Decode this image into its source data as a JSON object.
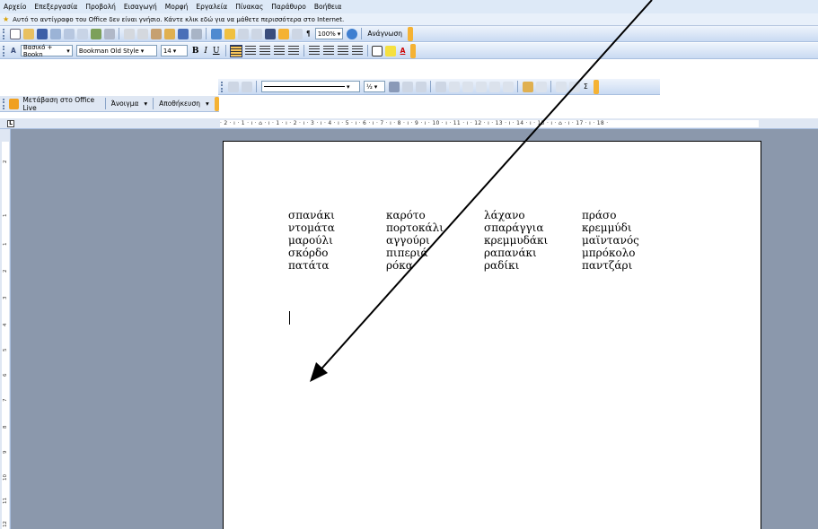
{
  "menu": [
    "Αρχείο",
    "Επεξεργασία",
    "Προβολή",
    "Εισαγωγή",
    "Μορφή",
    "Εργαλεία",
    "Πίνακας",
    "Παράθυρο",
    "Βοήθεια"
  ],
  "infobar": {
    "message": "Αυτό το αντίγραφο του Office δεν είναι γνήσιο. Κάντε κλικ εδώ για να μάθετε περισσότερα στο Internet."
  },
  "standard_toolbar": {
    "zoom": "100%",
    "read_button": "Ανάγνωση"
  },
  "format_toolbar": {
    "style": "Βασικό + Bookn",
    "font": "Bookman Old Style",
    "size": "14",
    "bold": "B",
    "italic": "I",
    "underline": "U"
  },
  "office_live_toolbar": {
    "goto_label": "Μετάβαση στο Office Live",
    "open_label": "Άνοιγμα",
    "save_label": "Αποθήκευση"
  },
  "drawing_toolbar": {
    "line_weight": "½"
  },
  "ruler": {
    "horizontal": "· 2 · ı · 1 · ı · ⌂ · ı · 1 · ı · 2 · ı · 3 · ı · 4 · ı · 5 · ı · 6 · ı · 7 · ı · 8 · ı · 9 · ı · 10 · ı · 11 · ı · 12 · ı · 13 · ı · 14 · ı · 15 · ı · ⌂ · ı · 17 · ı · 18 ·",
    "vertical": [
      "2",
      "1",
      "1",
      "2",
      "3",
      "4",
      "5",
      "6",
      "7",
      "8",
      "9",
      "10",
      "11",
      "12"
    ]
  },
  "document": {
    "rows": [
      [
        "σπανάκι",
        "καρότο",
        "λάχανο",
        "πράσο"
      ],
      [
        "ντομάτα",
        "πορτοκάλι",
        "σπαράγγια",
        "κρεμμύδι"
      ],
      [
        "μαρούλι",
        "αγγούρι",
        "κρεμμυδάκι",
        "μαϊντανός"
      ],
      [
        "σκόρδο",
        "πιπεριά",
        "ραπανάκι",
        "μπρόκολο"
      ],
      [
        "πατάτα",
        "ρόκα",
        "ραδίκι",
        "παντζάρι"
      ]
    ]
  },
  "colors": {
    "workspace": "#8b98ac",
    "toolbar_top": "#eef4fc",
    "toolbar_bottom": "#c9daf2",
    "highlight": "#f7c65b"
  }
}
